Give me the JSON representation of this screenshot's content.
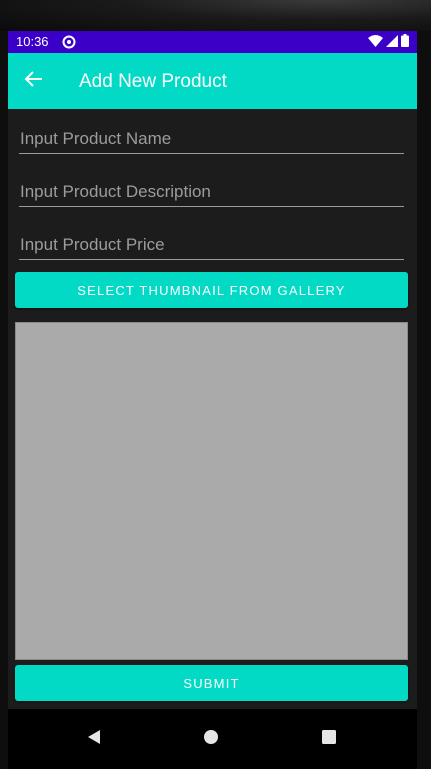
{
  "status_bar": {
    "time": "10:36",
    "background": "#3b00c7"
  },
  "app_bar": {
    "title": "Add New Product",
    "background": "#03dac6",
    "back_icon": "arrow-back-icon"
  },
  "form": {
    "name_placeholder": "Input Product Name",
    "description_placeholder": "Input Product Description",
    "price_placeholder": "Input Product Price",
    "select_thumbnail_label": "SELECT THUMBNAIL FROM GALLERY",
    "submit_label": "SUBMIT"
  },
  "colors": {
    "accent": "#03dac6",
    "thumbnail_placeholder": "#aaaaaa",
    "background": "#1c1c1c"
  },
  "nav_bar": {
    "icons": [
      "back-triangle-icon",
      "home-circle-icon",
      "recents-square-icon"
    ]
  }
}
